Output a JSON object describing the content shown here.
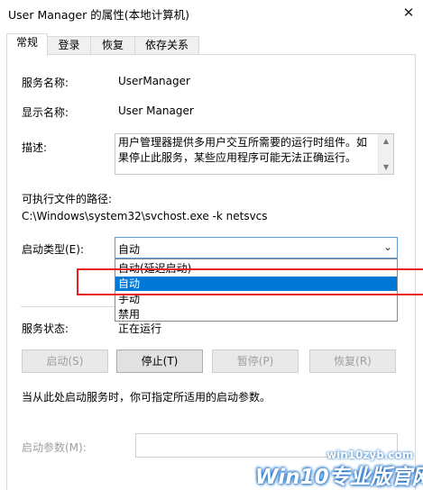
{
  "window": {
    "title": "User Manager 的属性(本地计算机)",
    "close_glyph": "✕"
  },
  "tabs": [
    {
      "label": "常规",
      "active": true
    },
    {
      "label": "登录",
      "active": false
    },
    {
      "label": "恢复",
      "active": false
    },
    {
      "label": "依存关系",
      "active": false
    }
  ],
  "general": {
    "service_name_label": "服务名称:",
    "service_name": "UserManager",
    "display_name_label": "显示名称:",
    "display_name": "User Manager",
    "description_label": "描述:",
    "description": "用户管理器提供多用户交互所需要的运行时组件。如果停止此服务，某些应用程序可能无法正确运行。",
    "exe_path_label": "可执行文件的路径:",
    "exe_path": "C:\\Windows\\system32\\svchost.exe -k netsvcs",
    "startup_type_label": "启动类型(E):",
    "startup_type_value": "自动",
    "startup_options": [
      "自动(延迟启动)",
      "自动",
      "手动",
      "禁用"
    ],
    "startup_selected_index": 1,
    "status_label": "服务状态:",
    "status_value": "正在运行",
    "buttons": {
      "start": "启动(S)",
      "stop": "停止(T)",
      "pause": "暂停(P)",
      "resume": "恢复(R)"
    },
    "hint": "当从此处启动服务时，你可指定所适用的启动参数。",
    "start_params_label": "启动参数(M):",
    "start_params_value": ""
  },
  "watermark": {
    "url": "win10zyb.com",
    "brand": "Win10专业版官网"
  },
  "colors": {
    "highlight": "#0078d7",
    "annotation_red": "#e81e1e",
    "combo_border": "#5d9bd6"
  }
}
